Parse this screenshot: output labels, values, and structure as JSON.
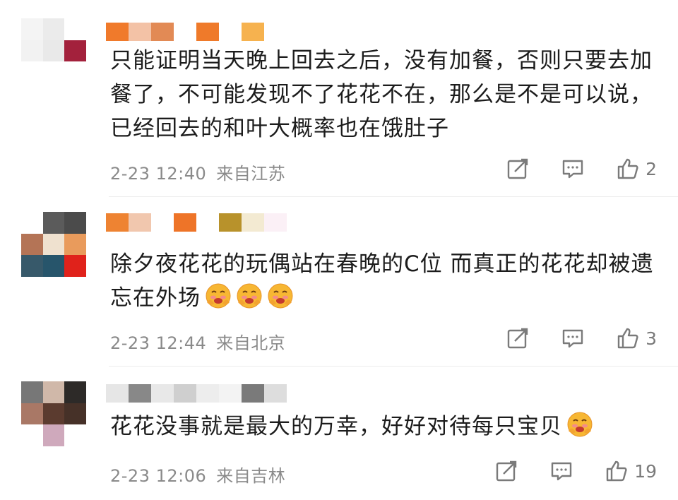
{
  "comments": [
    {
      "text": "只能证明当天晚上回去之后，没有加餐，否则只要去加餐了，不可能发现不了花花不在，那么是不是可以说，已经回去的和叶大概率也在饿肚子",
      "date": "2-23 12:40",
      "location": "来自江苏",
      "likes": "2",
      "avatar_colors": [
        "#f4f4f4",
        "#ebebeb",
        "#ffffff",
        "#f2f2f2",
        "#e9e9e9",
        "#a3213c",
        "#ffffff",
        "#ffffff",
        "#ffffff"
      ],
      "name_colors": [
        "#f07a2b",
        "#f3c2a6",
        "#e28a55",
        "#ffffff",
        "#ef7a2a",
        "#ffffff",
        "#f6b24f"
      ]
    },
    {
      "text": "除夕夜花花的玩偶站在春晚的C位 而真正的花花却被遗忘在外场",
      "emoji_count": 3,
      "date": "2-23 12:44",
      "location": "来自北京",
      "likes": "3",
      "avatar_colors": [
        "#ffffff",
        "#5b5b5b",
        "#4b4b4b",
        "#b47456",
        "#efe1cf",
        "#e99b5c",
        "#37596a",
        "#27556b",
        "#e0221b"
      ],
      "name_colors": [
        "#ee8332",
        "#f1c7ae",
        "#ffffff",
        "#ee7428",
        "#ffffff",
        "#b8922b",
        "#f3ead2",
        "#fbf0f6"
      ]
    },
    {
      "text": "花花没事就是最大的万幸，好好对待每只宝贝",
      "emoji_count": 1,
      "date": "2-23 12:06",
      "location": "来自吉林",
      "likes": "19",
      "avatar_colors": [
        "#777777",
        "#d0b8a9",
        "#2d2a28",
        "#a97866",
        "#5b3b2f",
        "#463128",
        "#ffffff",
        "#cfa9bc",
        "#ffffff"
      ],
      "name_colors": [
        "#e6e6e6",
        "#888888",
        "#e8e8e8",
        "#cfcfcf",
        "#ededed",
        "#f3f3f3",
        "#7a7a7a",
        "#dddddd"
      ]
    }
  ],
  "icons": {
    "repost": "share-edit-icon",
    "comment": "comment-icon",
    "like": "thumbs-up-icon"
  }
}
